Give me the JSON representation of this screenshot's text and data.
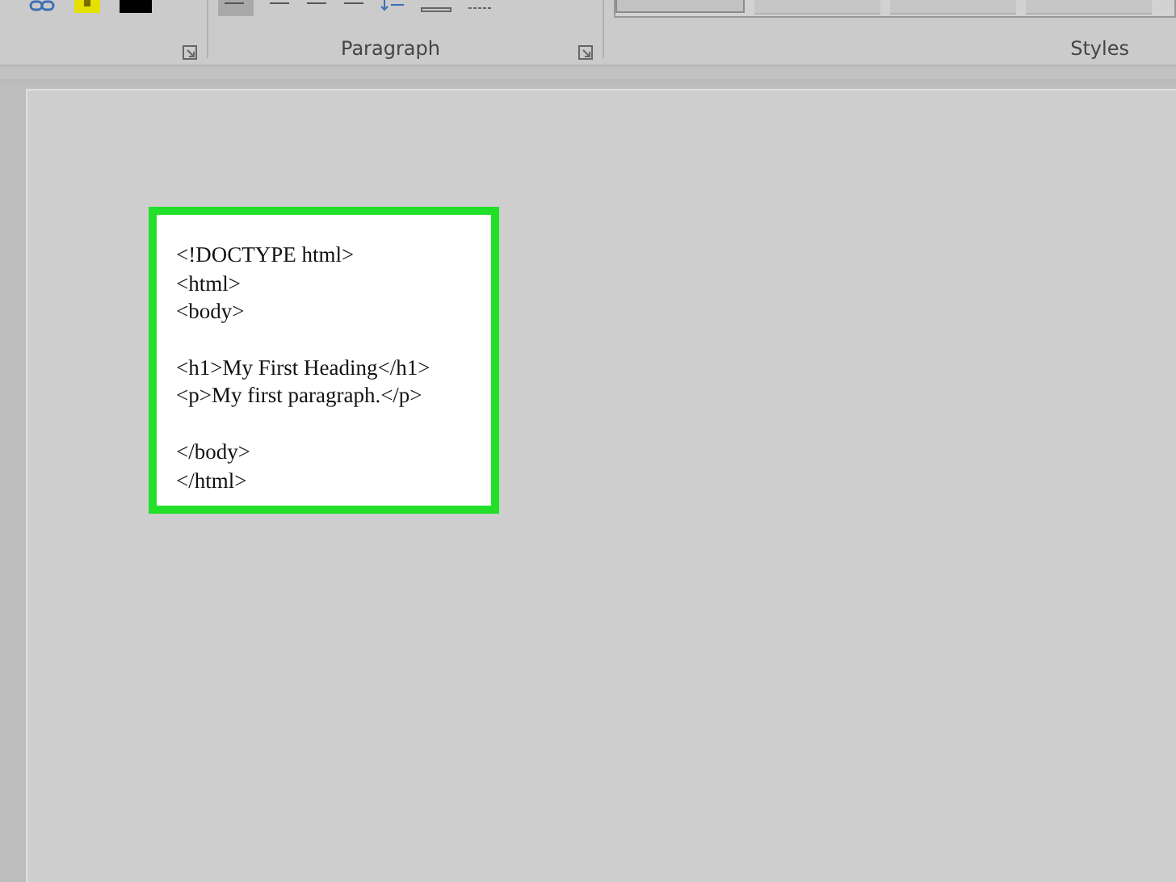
{
  "ribbon": {
    "groups": [
      {
        "label": "Paragraph"
      },
      {
        "label": "Styles"
      }
    ]
  },
  "document": {
    "highlighted": true,
    "code_blocks": [
      [
        "<!DOCTYPE html>",
        "<html>",
        "<body>"
      ],
      [
        "<h1>My First Heading</h1>",
        "<p>My first paragraph.</p>"
      ],
      [
        "</body>",
        "</html>"
      ]
    ]
  }
}
